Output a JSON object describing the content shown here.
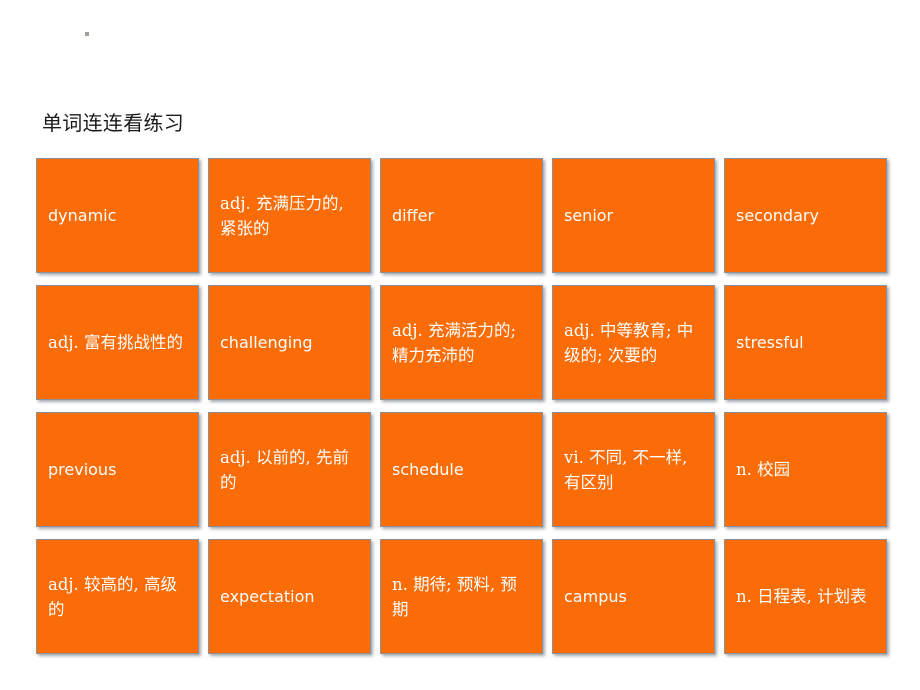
{
  "slide": {
    "title": "单词连连看练习",
    "background_color": "#ffffff",
    "corner_mark": "bullet-dot"
  },
  "style": {
    "card_fill": "#f96c07",
    "card_border": "#8c9099",
    "card_text_color": "#ffffff",
    "title_color": "#1a1a1a"
  },
  "grid": {
    "columns": 5,
    "rows": 4,
    "cards": [
      {
        "text": "dynamic",
        "script": "latin"
      },
      {
        "text": "adj. 充满压力的, 紧张的",
        "script": "cjk"
      },
      {
        "text": "differ",
        "script": "latin"
      },
      {
        "text": "senior",
        "script": "latin"
      },
      {
        "text": "secondary",
        "script": "latin"
      },
      {
        "text": "adj. 富有挑战性的",
        "script": "cjk"
      },
      {
        "text": "challenging",
        "script": "latin"
      },
      {
        "text": "adj. 充满活力的; 精力充沛的",
        "script": "cjk"
      },
      {
        "text": "adj. 中等教育; 中级的; 次要的",
        "script": "cjk"
      },
      {
        "text": "stressful",
        "script": "latin"
      },
      {
        "text": "previous",
        "script": "latin"
      },
      {
        "text": "adj. 以前的, 先前的",
        "script": "cjk"
      },
      {
        "text": "schedule",
        "script": "latin"
      },
      {
        "text": "vi. 不同, 不一样, 有区别",
        "script": "cjk"
      },
      {
        "text": "n. 校园",
        "script": "cjk"
      },
      {
        "text": "adj. 较高的, 高级的",
        "script": "cjk"
      },
      {
        "text": "expectation",
        "script": "latin"
      },
      {
        "text": "n. 期待; 预料, 预期",
        "script": "cjk"
      },
      {
        "text": "campus",
        "script": "latin"
      },
      {
        "text": "n. 日程表, 计划表",
        "script": "cjk"
      }
    ]
  }
}
